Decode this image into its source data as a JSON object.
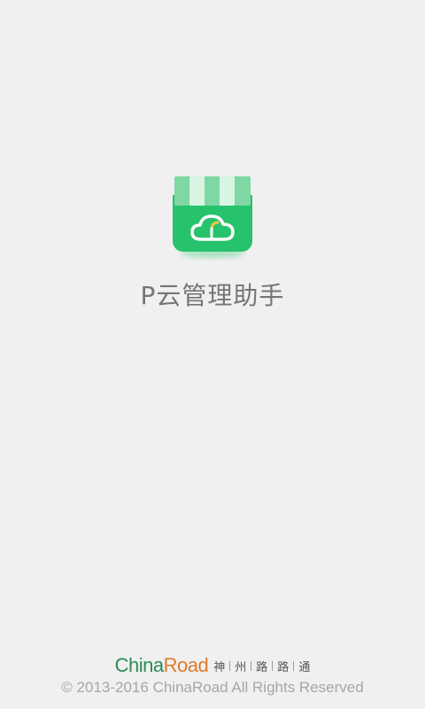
{
  "app": {
    "name": "P云管理助手",
    "logo_icon": "storefront-cloud-icon",
    "colors": {
      "background": "#f0f0f0",
      "logo_green": "#27c26c",
      "awning_light": "#d8f4e2",
      "awning_green": "#7fd7a3"
    }
  },
  "footer": {
    "brand_china": "China",
    "brand_road": "Road",
    "brand_colors": {
      "china": "#2e8b57",
      "road": "#e07a2d"
    },
    "tagline_chars": [
      "神",
      "州",
      "路",
      "路",
      "通"
    ],
    "copyright": "© 2013-2016 ChinaRoad All Rights Reserved"
  }
}
